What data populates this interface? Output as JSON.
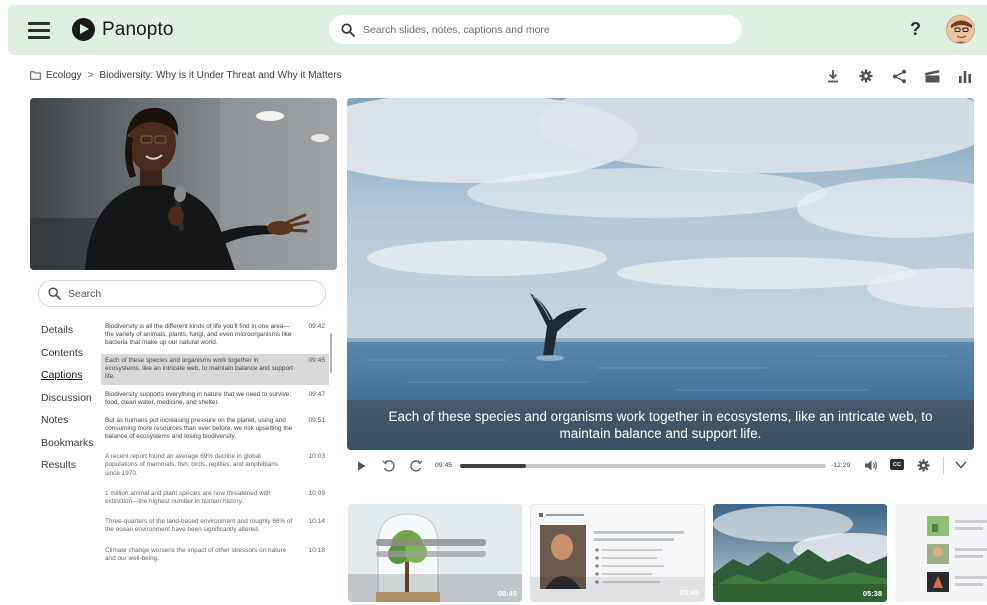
{
  "app": {
    "name": "Panopto"
  },
  "header": {
    "search_placeholder": "Search slides, notes, captions and more",
    "help_label": "?"
  },
  "breadcrumb": {
    "folder": "Ecology",
    "separator": ">",
    "current": "Biodiversity: Why is it Under Threat and Why it Matters"
  },
  "toolbar": [
    "download-icon",
    "gear-icon",
    "share-icon",
    "clapperboard-icon",
    "stats-icon"
  ],
  "sidebar": {
    "search_placeholder": "Search",
    "nav": [
      {
        "label": "Details"
      },
      {
        "label": "Contents"
      },
      {
        "label": "Captions",
        "active": true
      },
      {
        "label": "Discussion"
      },
      {
        "label": "Notes"
      },
      {
        "label": "Bookmarks"
      },
      {
        "label": "Results"
      }
    ],
    "captions": [
      {
        "text": "Biodiversity is all the different kinds of life you'll find in one area—the variety of animals, plants, fungi, and even microorganisms like bacteria that make up our natural world.",
        "time": "09:42"
      },
      {
        "text": "Each of these species and organisms work together in ecosystems, like an intricate web, to maintain balance and support life.",
        "time": "09:45",
        "active": true
      },
      {
        "text": "Biodiversity supports everything in nature that we need to survive: food, clean water, medicine, and shelter.",
        "time": "09:47"
      },
      {
        "text": "But as humans put increasing pressure on the planet, using and consuming more resources than ever before, we risk upsetting the balance of ecosystems and losing biodiversity.",
        "time": "09:51"
      },
      {
        "text": "A recent report found an average 69% decline in global populations of mammals, fish, birds, reptiles, and amphibians since 1970.",
        "time": "10:03",
        "faded": true
      },
      {
        "text": "1 million animal and plant species are now threatened with extinction—the highest number in human history.",
        "time": "10:09",
        "faded": true
      },
      {
        "text": "Three-quarters of the land-based environment and roughly 66% of the ocean environment have been significantly altered.",
        "time": "10:14",
        "faded": true
      },
      {
        "text": "Climate change worsens the impact of other stressors on nature and our well-being.",
        "time": "10:18",
        "faded": true
      }
    ]
  },
  "player": {
    "caption": "Each of these species and organisms work together in ecosystems, like an intricate web, to maintain balance and support life.",
    "elapsed": "09:45",
    "remaining": "-12:29",
    "progress": 0.18,
    "cc_label": "CC"
  },
  "thumbnails": [
    {
      "duration": "00:45",
      "kind": "terrarium"
    },
    {
      "duration": "03:45",
      "kind": "slide-speaker"
    },
    {
      "duration": "05:38",
      "kind": "forest"
    },
    {
      "duration": "",
      "kind": "slide-list"
    }
  ],
  "colors": {
    "header_bg": "#dff0e3",
    "accent_dark": "#3d3d3d"
  }
}
